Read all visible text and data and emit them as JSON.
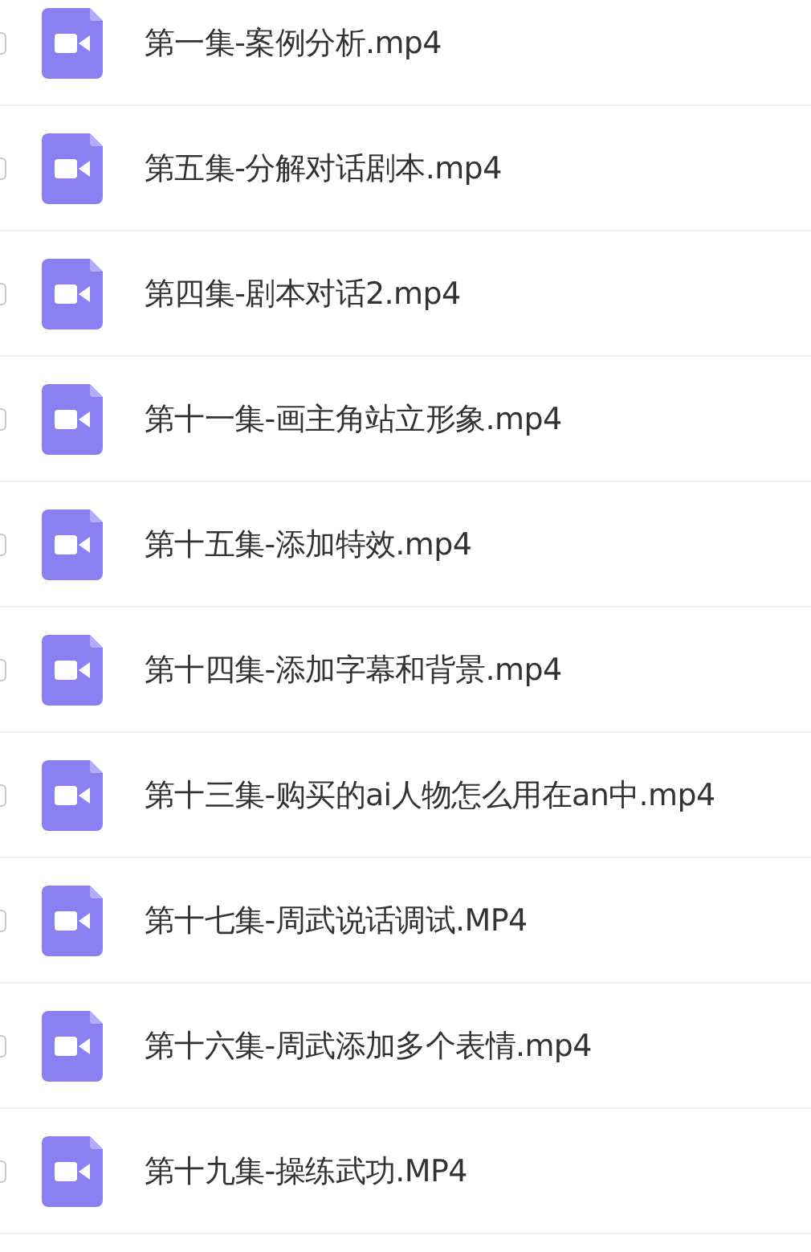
{
  "files": [
    {
      "name": "第一集-案例分析.mp4",
      "checked": false
    },
    {
      "name": "第五集-分解对话剧本.mp4",
      "checked": false
    },
    {
      "name": "第四集-剧本对话2.mp4",
      "checked": false
    },
    {
      "name": "第十一集-画主角站立形象.mp4",
      "checked": false
    },
    {
      "name": "第十五集-添加特效.mp4",
      "checked": false
    },
    {
      "name": "第十四集-添加字幕和背景.mp4",
      "checked": false
    },
    {
      "name": "第十三集-购买的ai人物怎么用在an中.mp4",
      "checked": false
    },
    {
      "name": "第十七集-周武说话调试.MP4",
      "checked": false
    },
    {
      "name": "第十六集-周武添加多个表情.mp4",
      "checked": false
    },
    {
      "name": "第十九集-操练武功.MP4",
      "checked": false
    }
  ]
}
